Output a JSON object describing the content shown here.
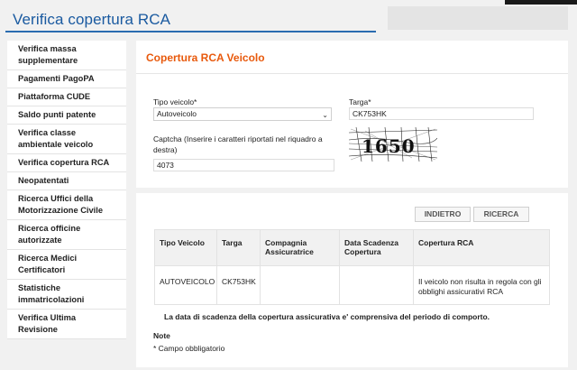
{
  "header": {
    "title": "Verifica copertura RCA"
  },
  "sidebar": {
    "items": [
      {
        "label": "Verifica massa supplementare"
      },
      {
        "label": "Pagamenti PagoPA"
      },
      {
        "label": "Piattaforma CUDE"
      },
      {
        "label": "Saldo punti patente"
      },
      {
        "label": "Verifica classe ambientale veicolo"
      },
      {
        "label": "Verifica copertura RCA"
      },
      {
        "label": "Neopatentati"
      },
      {
        "label": "Ricerca Uffici della Motorizzazione Civile"
      },
      {
        "label": "Ricerca officine autorizzate"
      },
      {
        "label": "Ricerca Medici Certificatori"
      },
      {
        "label": "Statistiche immatricolazioni"
      },
      {
        "label": "Verifica Ultima Revisione"
      }
    ]
  },
  "main": {
    "title": "Copertura RCA Veicolo",
    "form": {
      "tipo_veicolo_label": "Tipo veicolo*",
      "tipo_veicolo_value": "Autoveicolo",
      "targa_label": "Targa*",
      "targa_value": "CK753HK",
      "captcha_label": "Captcha (Inserire i caratteri riportati nel riquadro a destra)",
      "captcha_value": "4073",
      "captcha_image_text": "1650"
    },
    "buttons": {
      "back": "INDIETRO",
      "search": "RICERCA"
    },
    "table": {
      "headers": [
        "Tipo Veicolo",
        "Targa",
        "Compagnia Assicuratrice",
        "Data Scadenza Copertura",
        "Copertura RCA"
      ],
      "rows": [
        [
          "AUTOVEICOLO",
          "CK753HK",
          "",
          "",
          "Il veicolo non risulta in regola con gli obblighi assicurativi RCA"
        ]
      ]
    },
    "notice": "La data di scadenza della copertura assicurativa e' comprensiva del periodo di comporto.",
    "note_label": "Note",
    "note_text": "* Campo obbligatorio"
  },
  "colors": {
    "brand_blue": "#1a5aa0",
    "accent_orange": "#e8590c",
    "page_bg": "#f1f1f1"
  }
}
